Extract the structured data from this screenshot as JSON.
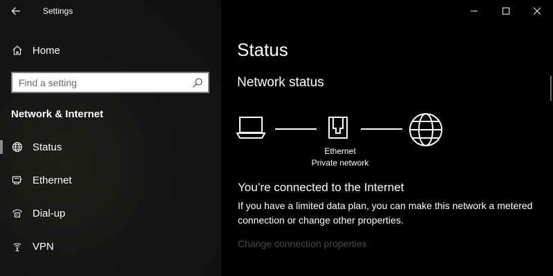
{
  "window": {
    "title": "Settings",
    "controls": [
      "minimize-icon",
      "maximize-icon",
      "close-icon"
    ]
  },
  "sidebar": {
    "back_icon": "back-arrow-icon",
    "home": {
      "label": "Home",
      "icon": "home-icon"
    },
    "search": {
      "value": "",
      "placeholder": "Find a setting",
      "icon": "search-icon"
    },
    "section_heading": "Network & Internet",
    "items": [
      {
        "label": "Status",
        "icon": "globe-icon",
        "active": true
      },
      {
        "label": "Ethernet",
        "icon": "ethernet-icon",
        "active": false
      },
      {
        "label": "Dial-up",
        "icon": "dialup-icon",
        "active": false
      },
      {
        "label": "VPN",
        "icon": "vpn-icon",
        "active": false
      }
    ]
  },
  "main": {
    "title": "Status",
    "subtitle": "Network status",
    "diagram": {
      "nodes": [
        "laptop-icon",
        "ethernet-port-icon",
        "globe-icon"
      ],
      "adapter_name": "Ethernet",
      "network_type": "Private network"
    },
    "connection_heading": "You’re connected to the Internet",
    "description": "If you have a limited data plan, you can make this network a metered connection or change other properties.",
    "link": "Change connection properties"
  },
  "colors": {
    "sidebar_bg": "#151513",
    "main_bg": "#000000",
    "text": "#ffffff",
    "link_disabled": "#4a4a4a",
    "search_border": "#7a7a7a"
  }
}
